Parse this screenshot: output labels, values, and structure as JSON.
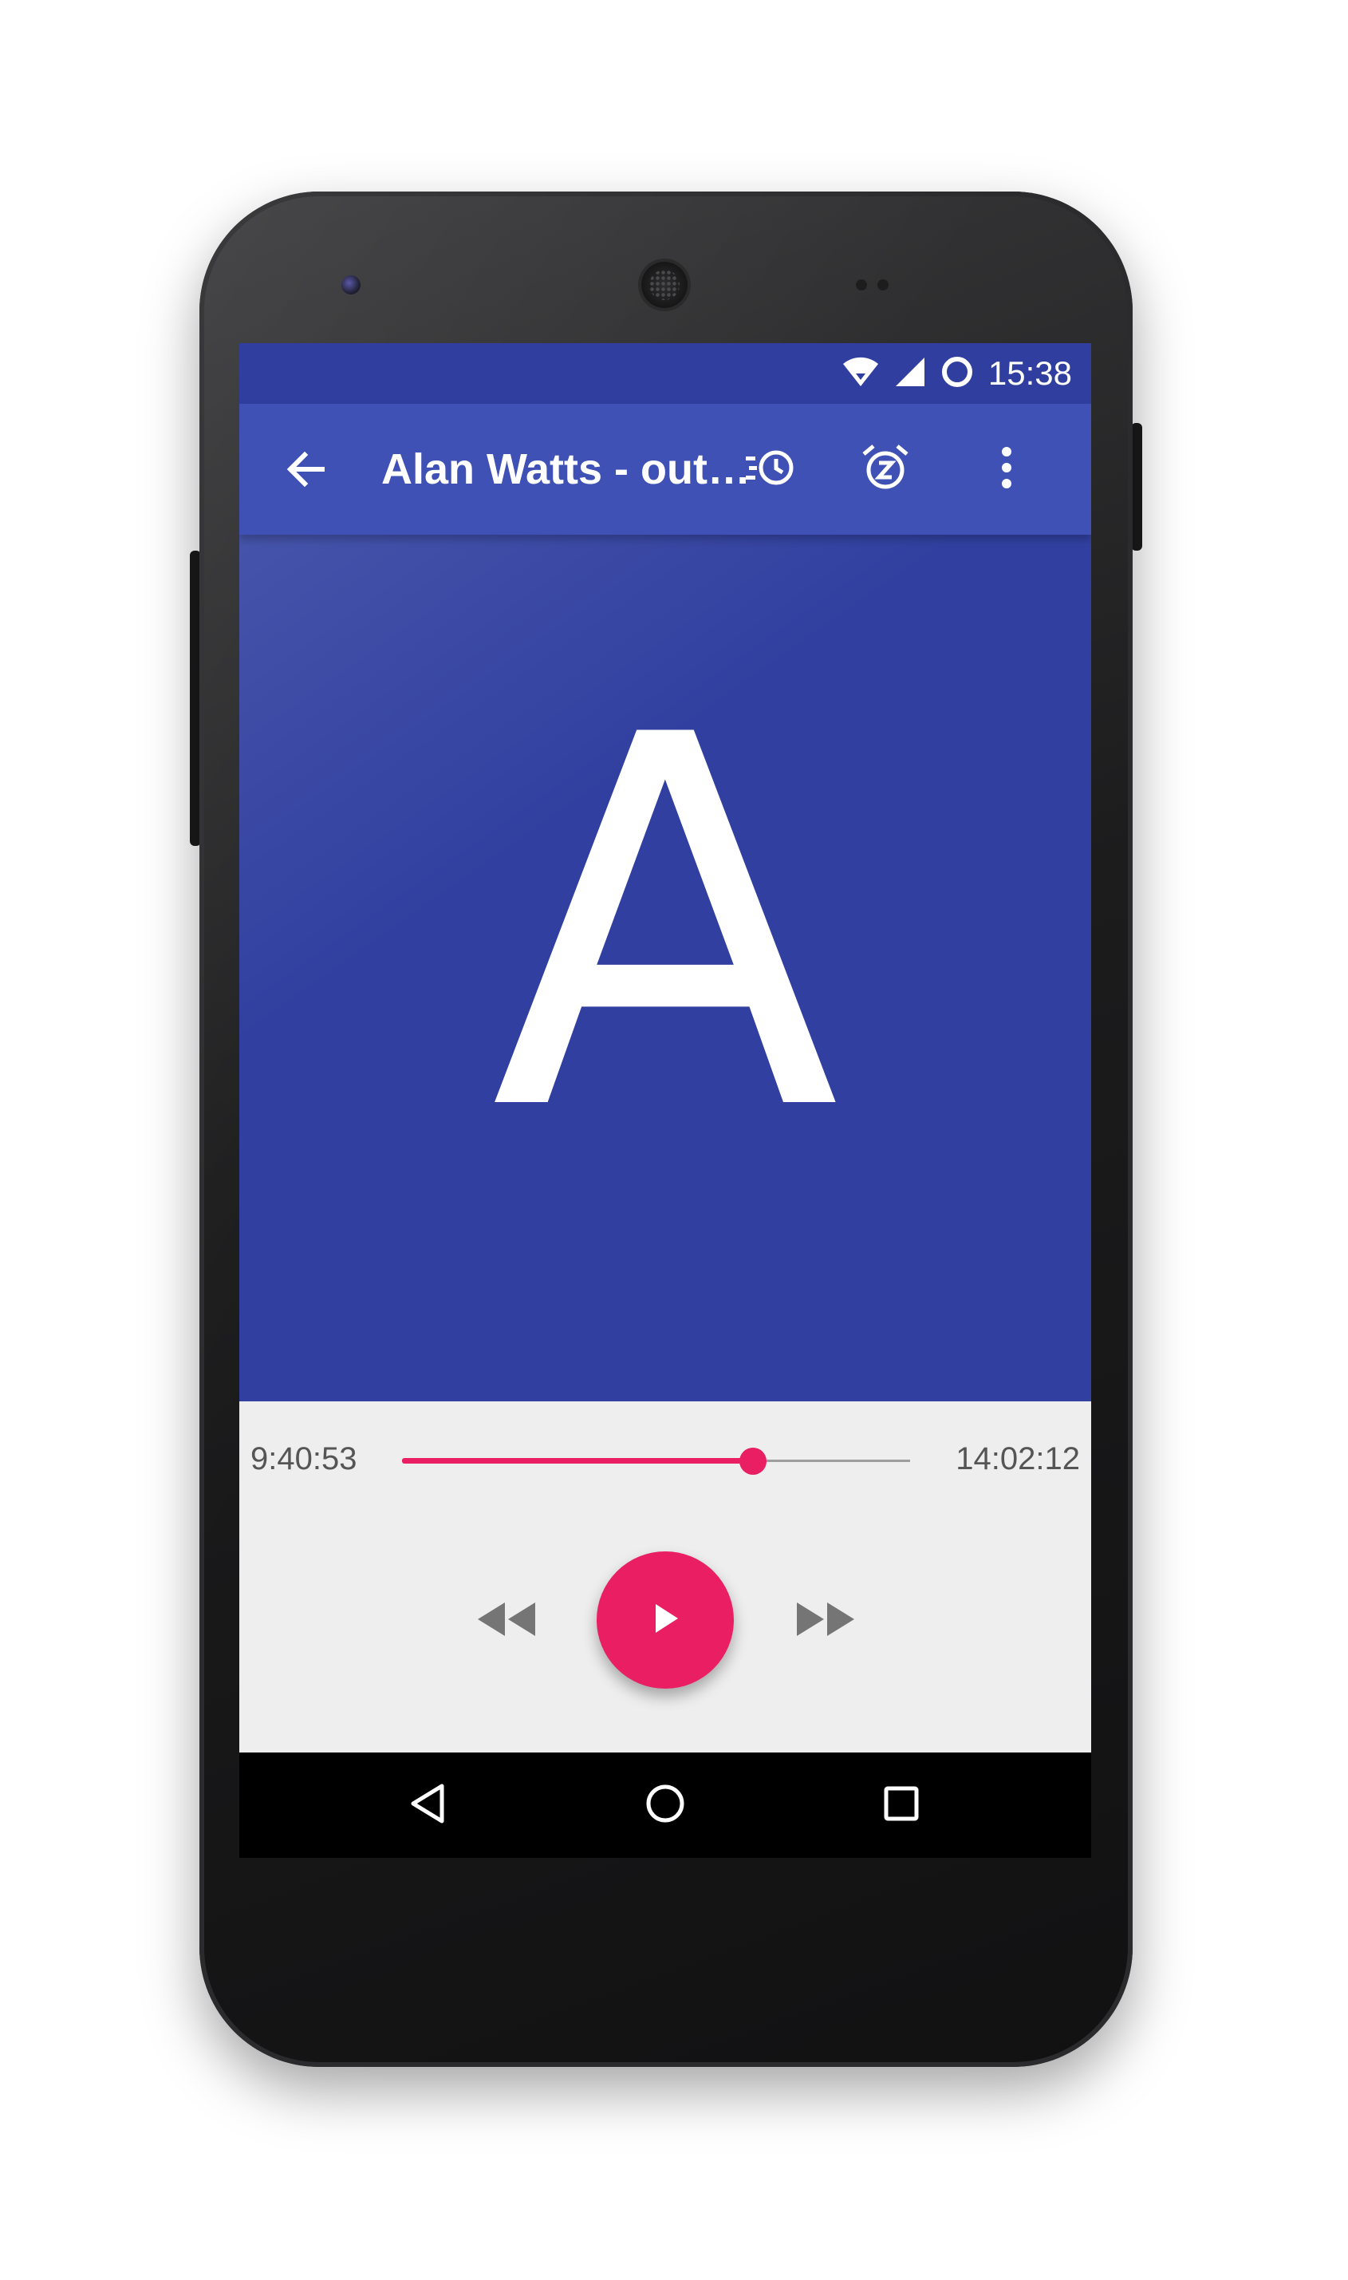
{
  "status_bar": {
    "time": "15:38",
    "icons": [
      "wifi-icon",
      "signal-icon",
      "circle-notification-icon"
    ]
  },
  "app_bar": {
    "back_icon": "arrow-back-icon",
    "title": "Alan Watts - out…",
    "actions": [
      "playback-speed-icon",
      "sleep-timer-icon",
      "more-vert-icon"
    ]
  },
  "cover": {
    "letter": "A",
    "background_color": "#3140a0"
  },
  "player": {
    "elapsed": "9:40:53",
    "total": "14:02:12",
    "progress_fraction": 0.69,
    "accent_color": "#e91e63",
    "buttons": [
      "rewind-icon",
      "play-icon",
      "fast-forward-icon"
    ]
  },
  "navigation": {
    "buttons": [
      "back-triangle-icon",
      "home-circle-icon",
      "recents-square-icon"
    ]
  },
  "colors": {
    "primary": "#3f51b5",
    "primary_dark": "#303f9f",
    "accent": "#e91e63",
    "controls_background": "#eeeeee"
  }
}
